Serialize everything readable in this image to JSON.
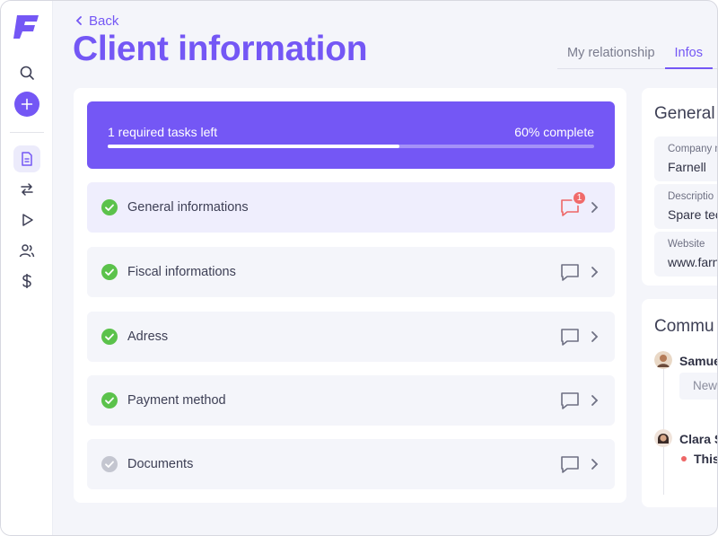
{
  "header": {
    "back_label": "Back",
    "title": "Client information",
    "tabs": [
      {
        "label": "My relationship",
        "active": false
      },
      {
        "label": "Infos",
        "active": true
      }
    ]
  },
  "sidebar": {
    "logo": "F",
    "items": [
      {
        "icon": "search-icon"
      },
      {
        "icon": "plus-icon"
      },
      {
        "icon": "document-icon",
        "active": true
      },
      {
        "icon": "transfer-icon"
      },
      {
        "icon": "play-icon"
      },
      {
        "icon": "users-icon"
      },
      {
        "icon": "dollar-icon"
      }
    ]
  },
  "progress": {
    "tasks_left": "1 required tasks left",
    "complete_label": "60% complete",
    "percent": 60
  },
  "sections": [
    {
      "label": "General informations",
      "done": true,
      "comments": 1,
      "highlight": true
    },
    {
      "label": "Fiscal informations",
      "done": true,
      "comments": 0
    },
    {
      "label": "Adress",
      "done": true,
      "comments": 0
    },
    {
      "label": "Payment method",
      "done": true,
      "comments": 0
    },
    {
      "label": "Documents",
      "done": false,
      "comments": 0
    }
  ],
  "badge_count": "1",
  "general_info": {
    "heading": "General i",
    "fields": [
      {
        "label": "Company n",
        "value": "Farnell"
      },
      {
        "label": "Descriptio",
        "value": "Spare tec"
      },
      {
        "label": "Website",
        "value": "www.farn"
      }
    ]
  },
  "communication": {
    "heading": "Commu",
    "entries": [
      {
        "name": "Samue",
        "message": "New"
      },
      {
        "name": "Clara S",
        "message": "This"
      }
    ]
  },
  "colors": {
    "brand": "#7457f5",
    "success": "#5bc24b",
    "pending": "#c4c6d0",
    "alert": "#f06a6a"
  }
}
